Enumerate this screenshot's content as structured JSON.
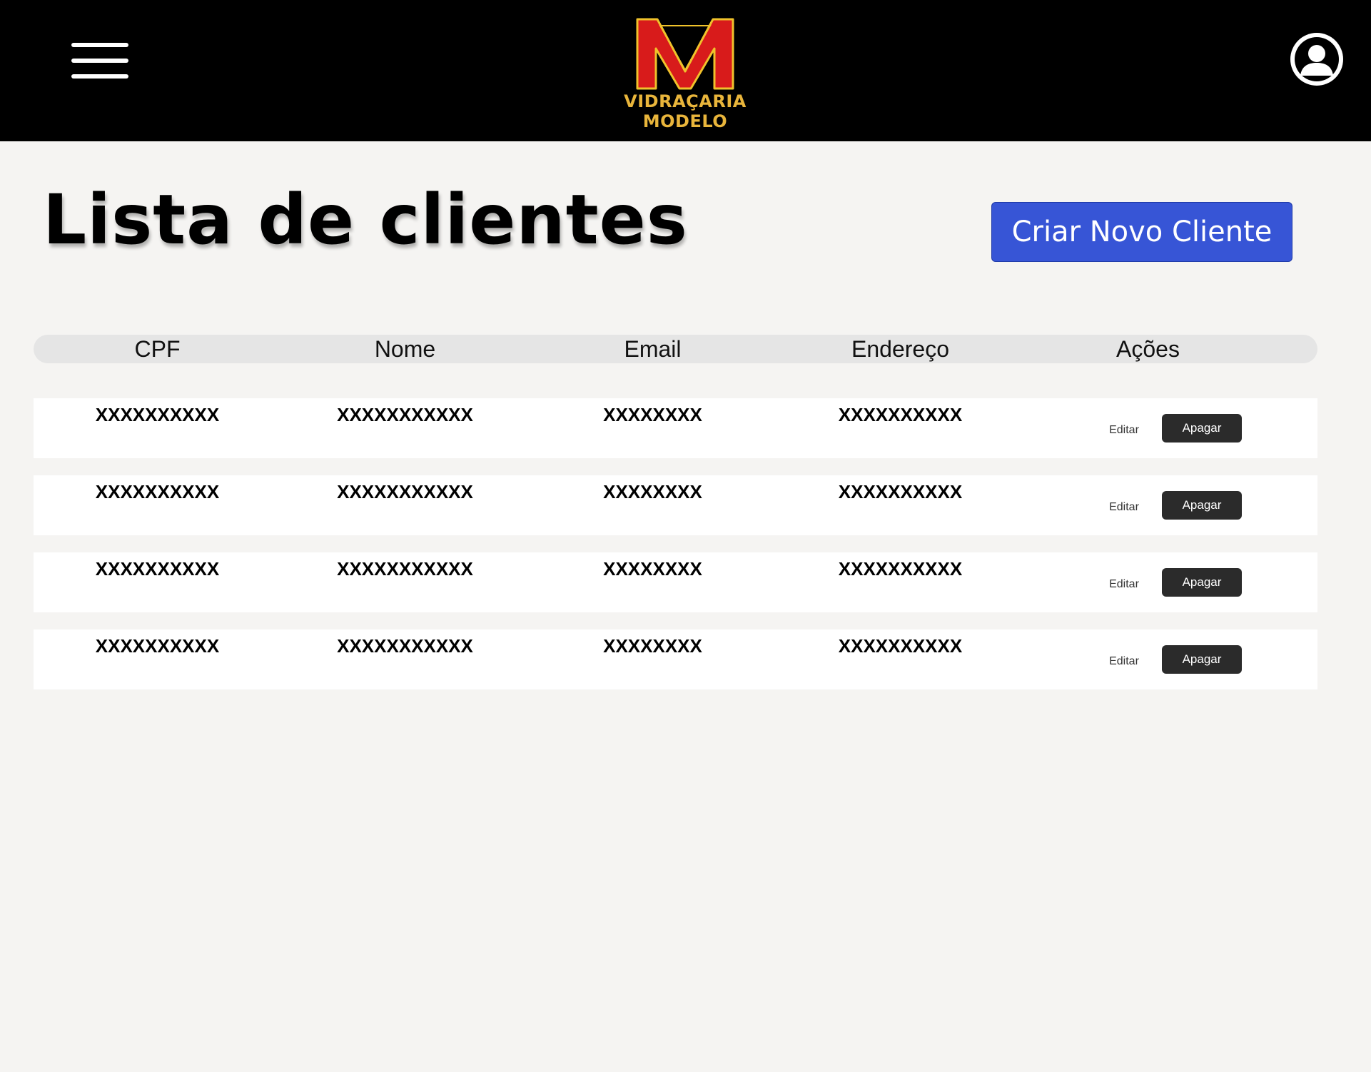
{
  "header": {
    "brand_name": "VIDRAÇARIA MODELO",
    "colors": {
      "background": "#000000",
      "logo_red": "#d81b1b",
      "logo_gold": "#e9b53b"
    },
    "menu_icon": "hamburger-menu-icon",
    "profile_icon": "user-avatar-icon"
  },
  "main": {
    "title": "Lista de clientes",
    "create_button": "Criar Novo Cliente",
    "accent_color": "#3755d6"
  },
  "table": {
    "columns": [
      "CPF",
      "Nome",
      "Email",
      "Endereço",
      "Ações"
    ],
    "rows": [
      {
        "cpf": "XXXXXXXXXX",
        "nome": "XXXXXXXXXXX",
        "email": "XXXXXXXX",
        "endereco": "XXXXXXXXXX",
        "edit": "Editar",
        "delete": "Apagar"
      },
      {
        "cpf": "XXXXXXXXXX",
        "nome": "XXXXXXXXXXX",
        "email": "XXXXXXXX",
        "endereco": "XXXXXXXXXX",
        "edit": "Editar",
        "delete": "Apagar"
      },
      {
        "cpf": "XXXXXXXXXX",
        "nome": "XXXXXXXXXXX",
        "email": "XXXXXXXX",
        "endereco": "XXXXXXXXXX",
        "edit": "Editar",
        "delete": "Apagar"
      },
      {
        "cpf": "XXXXXXXXXX",
        "nome": "XXXXXXXXXXX",
        "email": "XXXXXXXX",
        "endereco": "XXXXXXXXXX",
        "edit": "Editar",
        "delete": "Apagar"
      }
    ]
  }
}
